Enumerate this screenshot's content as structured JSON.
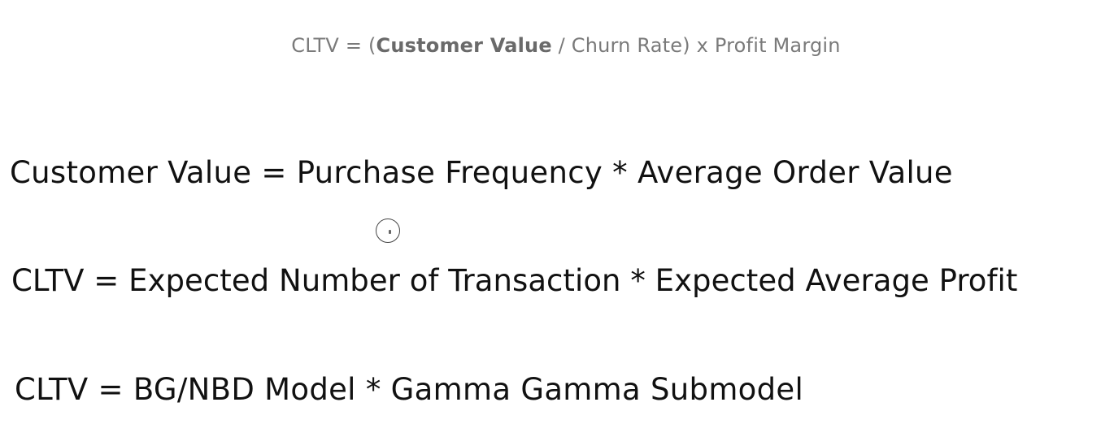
{
  "formula_top": {
    "prefix": "CLTV = (",
    "bold": "Customer Value",
    "suffix": " / Churn Rate) x Profit Margin"
  },
  "formula_customer_value": "Customer Value = Purchase Frequency * Average Order Value",
  "formula_cltv_expected": "CLTV = Expected Number of Transaction * Expected Average Profit",
  "formula_cltv_model": "CLTV = BG/NBD Model * Gamma Gamma Submodel",
  "icons": {
    "cursor": "cursor-circle-icon"
  },
  "colors": {
    "top_formula_text": "#7a7a7a",
    "main_text": "#111111",
    "background": "#ffffff"
  }
}
